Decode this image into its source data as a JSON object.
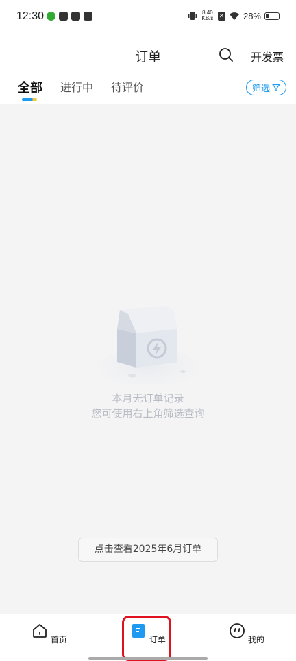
{
  "status_bar": {
    "time": "12:30",
    "netspeed_value": "8.40",
    "netspeed_unit": "KB/s",
    "battery": "28%"
  },
  "header": {
    "title": "订单",
    "invoice_label": "开发票",
    "tabs": [
      {
        "label": "全部",
        "active": true
      },
      {
        "label": "进行中",
        "active": false
      },
      {
        "label": "待评价",
        "active": false
      }
    ],
    "filter_label": "筛选"
  },
  "empty_state": {
    "line1": "本月无订单记录",
    "line2": "您可使用右上角筛选查询"
  },
  "history_button": "点击查看2025年6月订单",
  "bottom_nav": {
    "items": [
      {
        "label": "首页",
        "icon": "home-icon"
      },
      {
        "label": "订单",
        "icon": "orders-icon",
        "active": true
      },
      {
        "label": "我的",
        "icon": "profile-icon"
      }
    ]
  },
  "colors": {
    "accent": "#1e9bf0",
    "highlight": "#e0121f",
    "background": "#f4f4f5"
  }
}
